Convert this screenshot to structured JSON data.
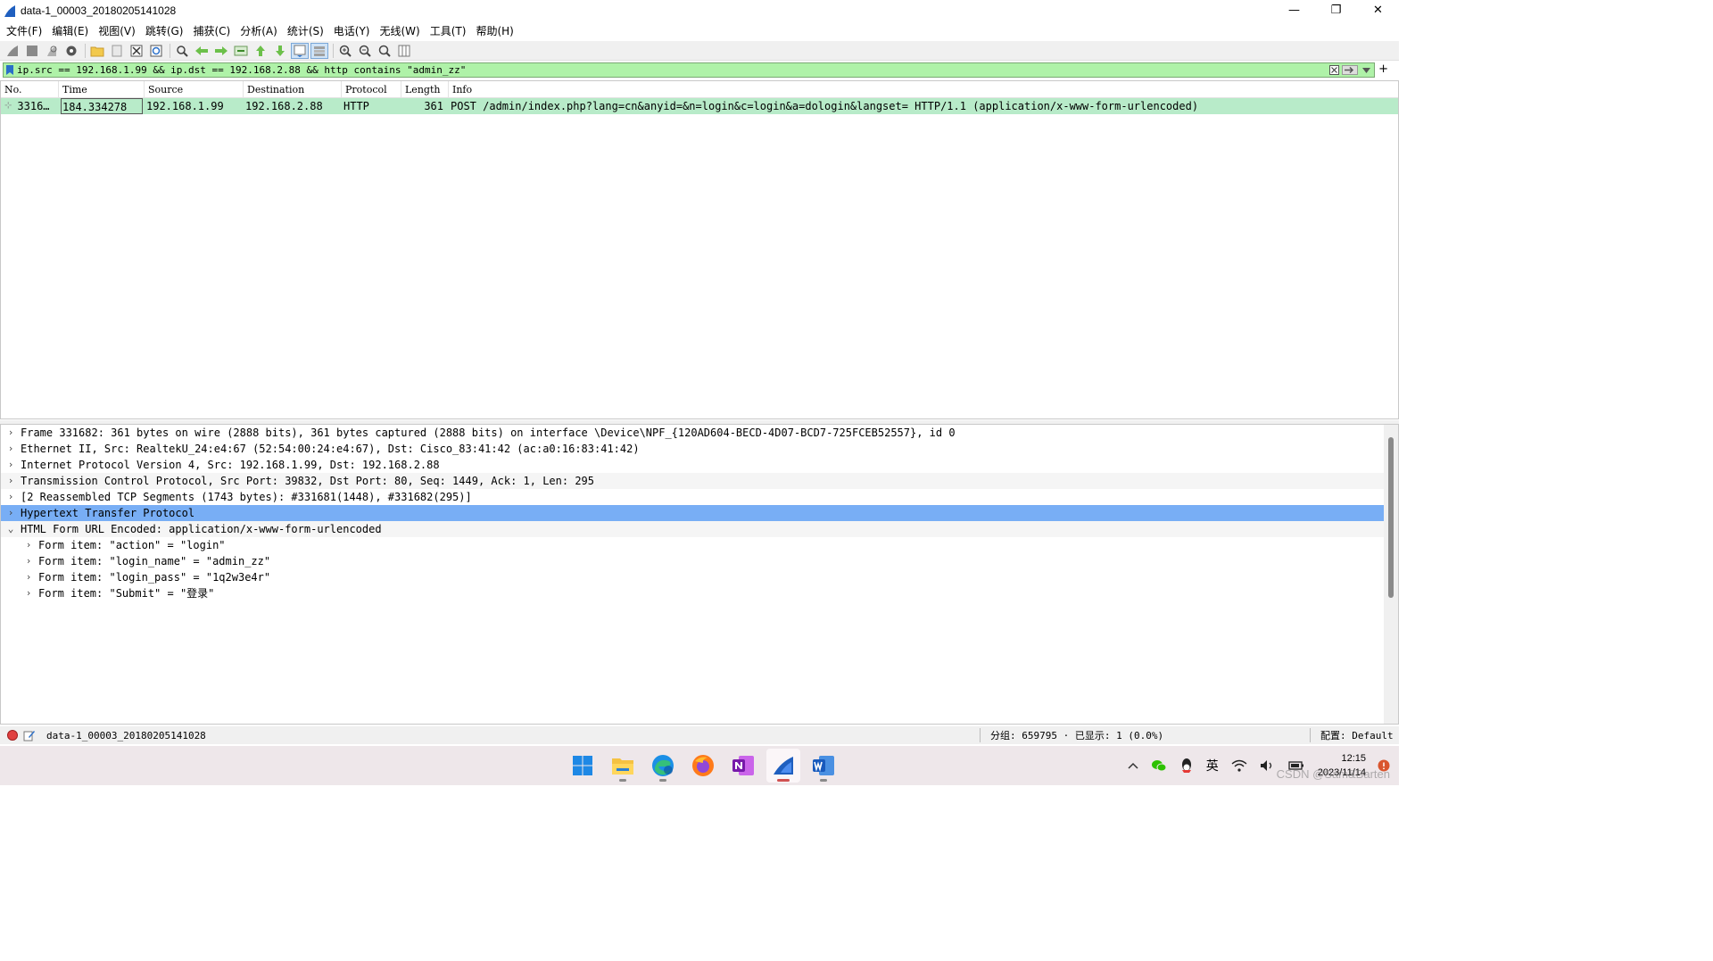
{
  "window": {
    "title": "data-1_00003_20180205141028",
    "minimize": "—",
    "restore": "❐",
    "close": "✕"
  },
  "menu": [
    "文件(F)",
    "编辑(E)",
    "视图(V)",
    "跳转(G)",
    "捕获(C)",
    "分析(A)",
    "统计(S)",
    "电话(Y)",
    "无线(W)",
    "工具(T)",
    "帮助(H)"
  ],
  "filter": {
    "value": "ip.src == 192.168.1.99 && ip.dst == 192.168.2.88 && http contains \"admin_zz\"",
    "plus": "+"
  },
  "packet_list": {
    "columns": [
      "No.",
      "Time",
      "Source",
      "Destination",
      "Protocol",
      "Length",
      "Info"
    ],
    "rows": [
      {
        "no": "3316…",
        "time": "184.334278",
        "source": "192.168.1.99",
        "destination": "192.168.2.88",
        "protocol": "HTTP",
        "length": "361",
        "info": "POST /admin/index.php?lang=cn&anyid=&n=login&c=login&a=dologin&langset= HTTP/1.1  (application/x-www-form-urlencoded)"
      }
    ]
  },
  "details": [
    {
      "text": "Frame 331682: 361 bytes on wire (2888 bits), 361 bytes captured (2888 bits) on interface \\Device\\NPF_{120AD604-BECD-4D07-BCD7-725FCEB52557}, id 0",
      "expanded": false
    },
    {
      "text": "Ethernet II, Src: RealtekU_24:e4:67 (52:54:00:24:e4:67), Dst: Cisco_83:41:42 (ac:a0:16:83:41:42)",
      "expanded": false
    },
    {
      "text": "Internet Protocol Version 4, Src: 192.168.1.99, Dst: 192.168.2.88",
      "expanded": false
    },
    {
      "text": "Transmission Control Protocol, Src Port: 39832, Dst Port: 80, Seq: 1449, Ack: 1, Len: 295",
      "expanded": false
    },
    {
      "text": "[2 Reassembled TCP Segments (1743 bytes): #331681(1448), #331682(295)]",
      "expanded": false
    },
    {
      "text": "Hypertext Transfer Protocol",
      "expanded": false
    },
    {
      "text": "HTML Form URL Encoded: application/x-www-form-urlencoded",
      "expanded": true
    },
    {
      "text": "Form item: \"action\" = \"login\"",
      "expanded": false
    },
    {
      "text": "Form item: \"login_name\" = \"admin_zz\"",
      "expanded": false
    },
    {
      "text": "Form item: \"login_pass\" = \"1q2w3e4r\"",
      "expanded": false
    },
    {
      "text": "Form item: \"Submit\" = \"登录\"",
      "expanded": false
    }
  ],
  "status": {
    "file": "data-1_00003_20180205141028",
    "packets": "分组: 659795 · 已显示: 1 (0.0%)",
    "profile": "配置: Default"
  },
  "taskbar": {
    "tray_lang": "英",
    "time": "12:15",
    "date": "2023/11/14",
    "watermark": "CSDN @Sam&Barten"
  },
  "colors": {
    "filter_bg": "#aff2a8",
    "row_bg": "#b8ebc9",
    "selected_bg": "#78aef5"
  }
}
